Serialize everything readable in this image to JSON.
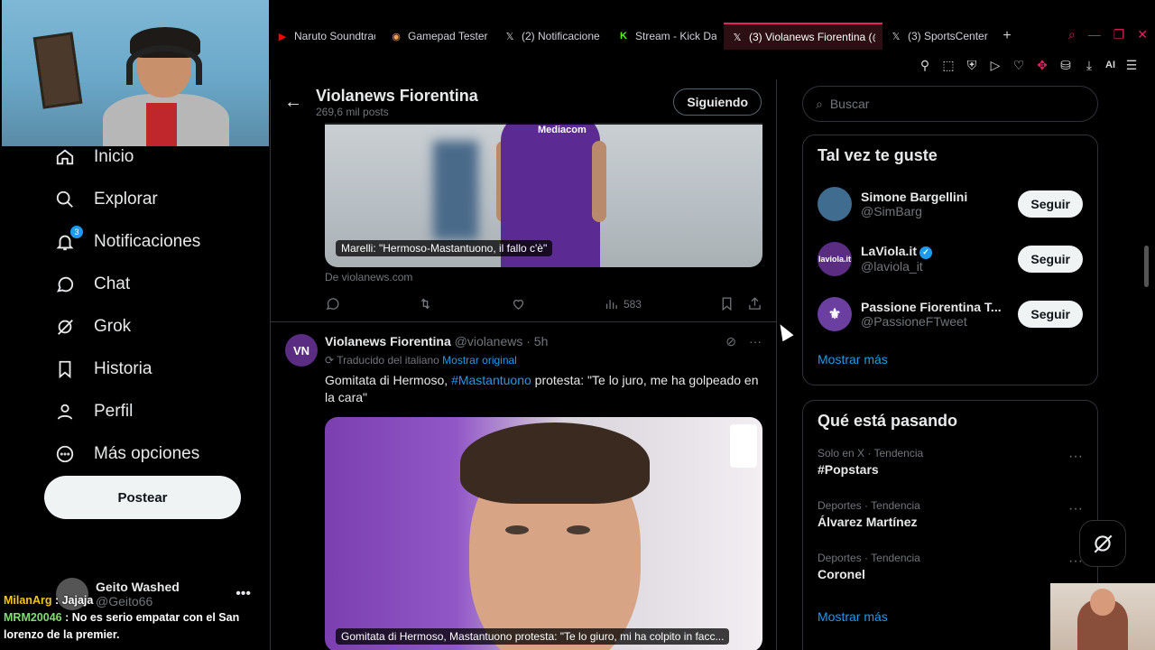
{
  "browser": {
    "tabs": [
      {
        "label": "Naruto Soundtrac",
        "icon": "youtube-icon",
        "color": "#ff0000"
      },
      {
        "label": "Gamepad Tester",
        "icon": "gamepad-icon",
        "color": "#f0a24c"
      },
      {
        "label": "(2) Notificacione",
        "icon": "x-icon",
        "color": "#ffffff"
      },
      {
        "label": "Stream - Kick Da",
        "icon": "kick-icon",
        "color": "#53fc18"
      },
      {
        "label": "(3) Violanews Fiorentina (@",
        "icon": "x-icon",
        "color": "#ffffff",
        "active": true
      },
      {
        "label": "(3) SportsCenter",
        "icon": "x-icon",
        "color": "#ffffff"
      }
    ],
    "new_tab": "+",
    "toolbar_ai": "AI"
  },
  "nav": {
    "items": [
      {
        "label": "Inicio",
        "icon": "home-icon"
      },
      {
        "label": "Explorar",
        "icon": "search-icon"
      },
      {
        "label": "Notificaciones",
        "icon": "bell-icon",
        "badge": "3"
      },
      {
        "label": "Chat",
        "icon": "chat-icon"
      },
      {
        "label": "Grok",
        "icon": "grok-icon"
      },
      {
        "label": "Historia",
        "icon": "bookmark-icon"
      },
      {
        "label": "Perfil",
        "icon": "person-icon"
      },
      {
        "label": "Más opciones",
        "icon": "more-circle-icon"
      }
    ],
    "post_button": "Postear",
    "account": {
      "name": "Geito Washed",
      "handle": "@Geito66"
    }
  },
  "chat_overlay": [
    {
      "user": "MilanArg",
      "message": ": Jajaja"
    },
    {
      "user": "MRM20046",
      "message": ": No es serio empatar con el San lorenzo de la premier."
    }
  ],
  "header": {
    "title": "Violanews Fiorentina",
    "subtitle": "269,6 mil posts",
    "follow_button": "Siguiendo"
  },
  "tweet1": {
    "sponsor": "Mediacom",
    "caption": "Marelli: \"Hermoso-Mastantuono, il fallo c'è\"",
    "source": "De violanews.com",
    "views": "583"
  },
  "tweet2": {
    "avatar_text": "VN",
    "name": "Violanews Fiorentina",
    "handle": "@violanews",
    "time": "· 5h",
    "translated": "Traducido del italiano",
    "show_original": "Mostrar original",
    "text_before": "Gomitata di Hermoso, ",
    "hashtag": "#Mastantuono",
    "text_after": " protesta: \"Te lo juro, me ha golpeado en la cara\"",
    "caption": "Gomitata di Hermoso, Mastantuono protesta: \"Te lo giuro, mi ha colpito in facc..."
  },
  "search": {
    "placeholder": "Buscar"
  },
  "who_to_follow": {
    "title": "Tal vez te guste",
    "users": [
      {
        "name": "Simone Bargellini",
        "handle": "@SimBarg",
        "button": "Seguir",
        "avatar_color": "#3f6c8f",
        "avatar_text": ""
      },
      {
        "name": "LaViola.it",
        "handle": "@laviola_it",
        "button": "Seguir",
        "avatar_color": "#5a2d82",
        "avatar_text": "laviola.it",
        "verified": true
      },
      {
        "name": "Passione Fiorentina T...",
        "handle": "@PassioneFTweet",
        "button": "Seguir",
        "avatar_color": "#6b3fa0",
        "avatar_text": "⚜"
      }
    ],
    "more": "Mostrar más"
  },
  "trends": {
    "title": "Qué está pasando",
    "items": [
      {
        "meta": "Solo en X · Tendencia",
        "topic": "#Popstars"
      },
      {
        "meta": "Deportes · Tendencia",
        "topic": "Álvarez Martínez"
      },
      {
        "meta": "Deportes · Tendencia",
        "topic": "Coronel"
      }
    ],
    "more": "Mostrar más"
  }
}
